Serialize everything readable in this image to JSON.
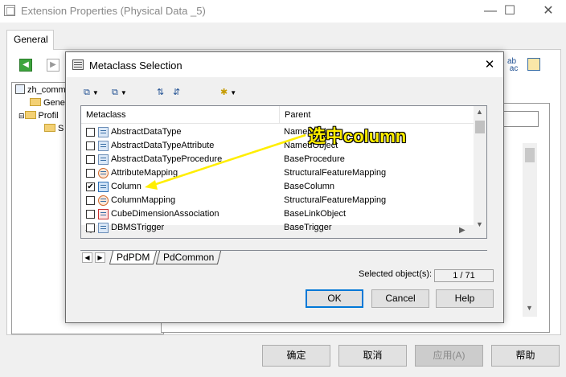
{
  "background_window": {
    "title": "Extension Properties (Physical Data _5)",
    "minimize_icon": "minimize-icon",
    "maximize_icon": "maximize-icon",
    "close_icon": "close-icon",
    "tab_general": "General",
    "tree": [
      {
        "label": "zh_comm",
        "level": 0
      },
      {
        "label": "Gene",
        "level": 1
      },
      {
        "label": "Profil",
        "level": 1
      },
      {
        "label": "S",
        "level": 2
      }
    ],
    "buttons": {
      "ok": "确定",
      "cancel": "取消",
      "apply": "应用(A)",
      "help": "帮助"
    },
    "toolbar_right_text": "ab ac"
  },
  "dialog": {
    "title": "Metaclass Selection",
    "close_glyph": "✕",
    "columns": {
      "metaclass": "Metaclass",
      "parent": "Parent"
    },
    "rows": [
      {
        "name": "AbstractDataType",
        "parent": "NamedObject",
        "checked": false
      },
      {
        "name": "AbstractDataTypeAttribute",
        "parent": "NamedObject",
        "checked": false
      },
      {
        "name": "AbstractDataTypeProcedure",
        "parent": "BaseProcedure",
        "checked": false
      },
      {
        "name": "AttributeMapping",
        "parent": "StructuralFeatureMapping",
        "checked": false
      },
      {
        "name": "Column",
        "parent": "BaseColumn",
        "checked": true
      },
      {
        "name": "ColumnMapping",
        "parent": "StructuralFeatureMapping",
        "checked": false
      },
      {
        "name": "CubeDimensionAssociation",
        "parent": "BaseLinkObject",
        "checked": false
      },
      {
        "name": "DBMSTrigger",
        "parent": "BaseTrigger",
        "checked": false
      }
    ],
    "tabs": [
      "PdPDM",
      "PdCommon"
    ],
    "selected_label": "Selected object(s):",
    "selected_count": "1 / 71",
    "buttons": {
      "ok": "OK",
      "cancel": "Cancel",
      "help": "Help"
    }
  },
  "annotation": {
    "text": "选中column",
    "color": "#ffee00"
  },
  "colors": {
    "accent": "#0078d7",
    "window_bg": "#f0f0f0"
  }
}
